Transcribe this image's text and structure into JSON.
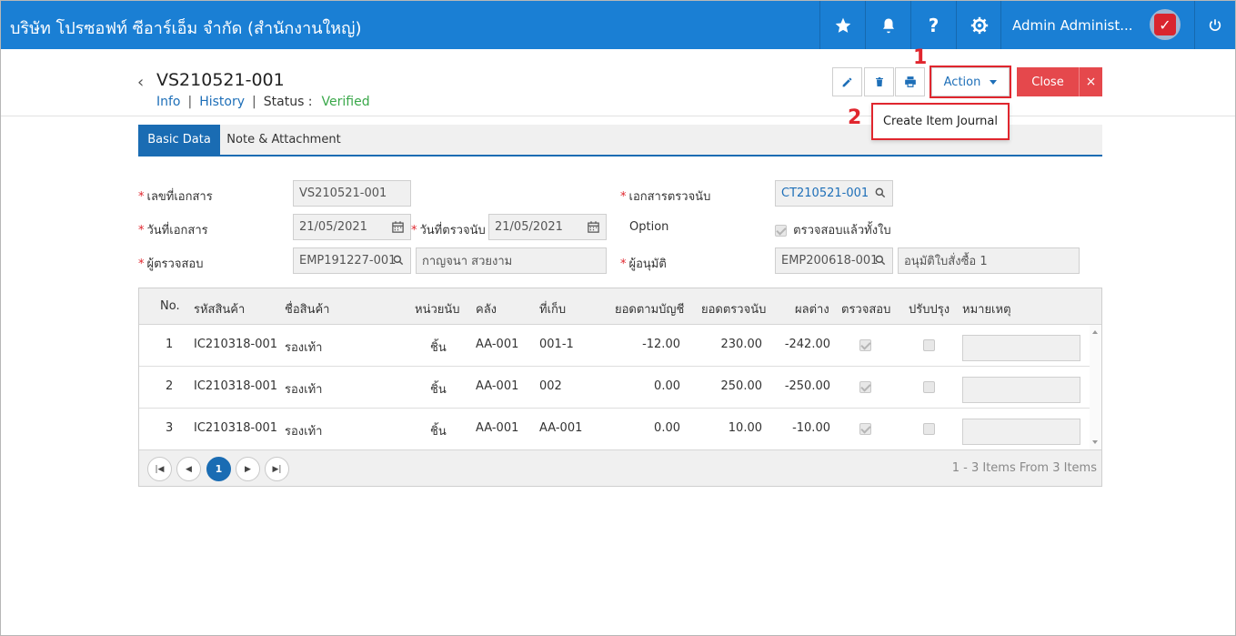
{
  "topbar": {
    "company": "บริษัท โปรซอฟท์ ซีอาร์เอ็ม จำกัด (สำนักงานใหญ่)",
    "user": "Admin Administ..."
  },
  "header": {
    "doc_no": "VS210521-001",
    "nav_info": "Info",
    "nav_history": "History",
    "status_label": "Status :",
    "status_value": "Verified"
  },
  "toolbar": {
    "action_label": "Action",
    "close_label": "Close",
    "close_x": "×"
  },
  "markers": {
    "one": "1",
    "two": "2"
  },
  "action_menu": {
    "item_create_journal": "Create Item Journal"
  },
  "tabs": {
    "basic": "Basic Data",
    "note": "Note & Attachment"
  },
  "form": {
    "doc_no_label": "เลขที่เอกสาร",
    "doc_no_value": "VS210521-001",
    "ref_doc_label": "เอกสารตรวจนับ",
    "ref_doc_value": "CT210521-001",
    "doc_date_label": "วันที่เอกสาร",
    "doc_date_value": "21/05/2021",
    "count_date_label": "วันที่ตรวจนับ",
    "count_date_value": "21/05/2021",
    "option_label": "Option",
    "option_check_label": "ตรวจสอบแล้วทั้งใบ",
    "inspector_label": "ผู้ตรวจสอบ",
    "inspector_code": "EMP191227-001",
    "inspector_name": "กาญจนา สวยงาม",
    "approver_label": "ผู้อนุมัติ",
    "approver_code": "EMP200618-001",
    "approver_name": "อนุมัติใบสั่งซื้อ 1"
  },
  "grid": {
    "headers": [
      "No.",
      "รหัสสินค้า",
      "ชื่อสินค้า",
      "หน่วยนับ",
      "คลัง",
      "ที่เก็บ",
      "ยอดตามบัญชี",
      "ยอดตรวจนับ",
      "ผลต่าง",
      "ตรวจสอบ",
      "ปรับปรุง",
      "หมายเหตุ"
    ],
    "rows": [
      {
        "no": "1",
        "code": "IC210318-001",
        "name": "รองเท้า",
        "unit": "ชิ้น",
        "wh": "AA-001",
        "loc": "001-1",
        "book": "-12.00",
        "counted": "230.00",
        "diff": "-242.00"
      },
      {
        "no": "2",
        "code": "IC210318-001",
        "name": "รองเท้า",
        "unit": "ชิ้น",
        "wh": "AA-001",
        "loc": "002",
        "book": "0.00",
        "counted": "250.00",
        "diff": "-250.00"
      },
      {
        "no": "3",
        "code": "IC210318-001",
        "name": "รองเท้า",
        "unit": "ชิ้น",
        "wh": "AA-001",
        "loc": "AA-001",
        "book": "0.00",
        "counted": "10.00",
        "diff": "-10.00"
      }
    ],
    "pager_current": "1",
    "pager_info": "1 - 3 Items From 3 Items"
  }
}
